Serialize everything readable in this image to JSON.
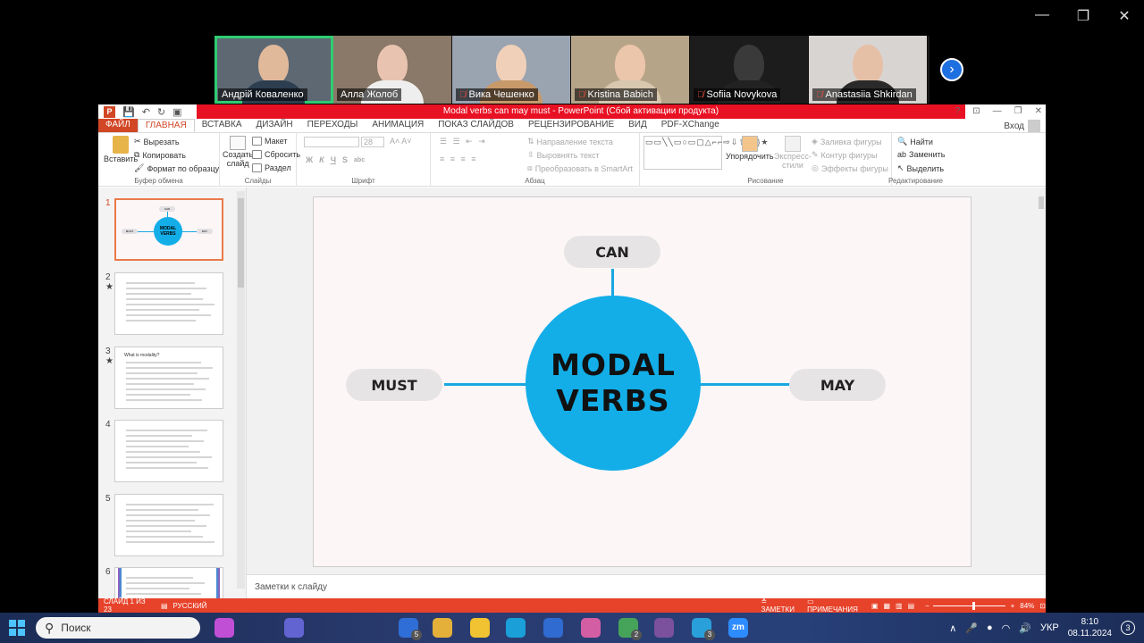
{
  "window_controls": {
    "minimize": "—",
    "restore": "❐",
    "close": "✕"
  },
  "participants": [
    {
      "name": "Андрій Коваленко",
      "muted": false,
      "active": true,
      "bg": "#5d6873",
      "skin": "#e0b89a",
      "shirt": "#2c3e50"
    },
    {
      "name": "Алла Жолоб",
      "muted": false,
      "active": false,
      "bg": "#8a7868",
      "skin": "#e8c4b0",
      "shirt": "#eeeeee"
    },
    {
      "name": "Вика Чешенко",
      "muted": true,
      "active": false,
      "bg": "#9aa3b0",
      "skin": "#f0d0b8",
      "shirt": "#c89a6a"
    },
    {
      "name": "Kristina Babich",
      "muted": true,
      "active": false,
      "bg": "#b6a488",
      "skin": "#ecc6ab",
      "shirt": "#d8c8b0"
    },
    {
      "name": "Sofiia Novykova",
      "muted": true,
      "active": false,
      "bg": "#1c1c1c",
      "skin": "#3a3a3a",
      "shirt": "#222222"
    },
    {
      "name": "Anastasiia Shkirdan",
      "muted": true,
      "active": false,
      "bg": "#d8d4d2",
      "skin": "#e6c0a6",
      "shirt": "#2a2a2a"
    }
  ],
  "next_icon": "›",
  "ppt": {
    "title": "Modal verbs can may must  -  PowerPoint (Сбой активации продукта)",
    "logo": "P",
    "qat": [
      "💾",
      "↶",
      "↻",
      "▣"
    ],
    "title_controls": [
      "?",
      "⊡",
      "—",
      "❐",
      "✕"
    ],
    "tabs": [
      "ФАЙЛ",
      "ГЛАВНАЯ",
      "ВСТАВКА",
      "ДИЗАЙН",
      "ПЕРЕХОДЫ",
      "АНИМАЦИЯ",
      "ПОКАЗ СЛАЙДОВ",
      "РЕЦЕНЗИРОВАНИЕ",
      "ВИД",
      "PDF-XChange"
    ],
    "login": "Вход",
    "ribbon": {
      "clipboard": {
        "paste": "Вставить",
        "cut": "Вырезать",
        "copy": "Копировать",
        "format": "Формат по образцу",
        "label": "Буфер обмена"
      },
      "slides": {
        "create": "Создать",
        "create2": "слайд",
        "layout": "Макет",
        "reset": "Сбросить",
        "section": "Раздел",
        "label": "Слайды"
      },
      "font": {
        "size": "28",
        "label": "Шрифт",
        "bold": "Ж",
        "italic": "К",
        "underline": "Ч",
        "strike": "S",
        "shadow": "abc"
      },
      "paragraph": {
        "direction": "Направление текста",
        "align": "Выровнять текст",
        "smartart": "Преобразовать в SmartArt",
        "label": "Абзац"
      },
      "drawing": {
        "arrange": "Упорядочить",
        "styles": "Экспресс-",
        "styles2": "стили",
        "fill": "Заливка фигуры",
        "outline": "Контур фигуры",
        "effects": "Эффекты фигуры",
        "label": "Рисование"
      },
      "editing": {
        "find": "Найти",
        "replace": "Заменить",
        "select": "Выделить",
        "label": "Редактирование"
      }
    },
    "slides": [
      {
        "num": "1",
        "star": ""
      },
      {
        "num": "2",
        "star": "★"
      },
      {
        "num": "3",
        "star": "★"
      },
      {
        "num": "4",
        "star": ""
      },
      {
        "num": "5",
        "star": ""
      },
      {
        "num": "6",
        "star": ""
      }
    ],
    "thumb1": {
      "center1": "MODAL",
      "center2": "VERBS",
      "top": "CAN",
      "left": "MUST",
      "right": "MAY"
    },
    "thumb3_heading": "What is modality?",
    "slide": {
      "top": "CAN",
      "left": "MUST",
      "right": "MAY",
      "center_line1": "MODAL",
      "center_line2": "VERBS"
    },
    "notes": "Заметки к слайду",
    "status": {
      "slide": "СЛАЙД 1 ИЗ 23",
      "lang": "РУССКИЙ",
      "notes": "ЗАМЕТКИ",
      "comments": "ПРИМЕЧАНИЯ",
      "zoom": "84%"
    }
  },
  "taskbar": {
    "search": "Поиск",
    "apps": [
      {
        "name": "copilot",
        "color": "#c14fd6"
      },
      {
        "name": "chat",
        "color": "#6264d1"
      },
      {
        "name": "mail",
        "color": "#2f6ed6",
        "badge": "5"
      },
      {
        "name": "chrome",
        "color": "#e4b03a"
      },
      {
        "name": "files",
        "color": "#f1c232"
      },
      {
        "name": "edge",
        "color": "#1a9fd8"
      },
      {
        "name": "store",
        "color": "#2f6bd0"
      },
      {
        "name": "snip",
        "color": "#d45ea3"
      },
      {
        "name": "chrome2",
        "color": "#46a35a",
        "badge": "2"
      },
      {
        "name": "viber",
        "color": "#7b519d"
      },
      {
        "name": "telegram",
        "color": "#2aa0da",
        "badge": "3"
      },
      {
        "name": "zoom",
        "color": "#2d8cff",
        "label": "zm"
      }
    ],
    "tray": {
      "lang": "УКР",
      "time": "8:10",
      "date": "08.11.2024",
      "notif": "3",
      "chevron": "∧"
    }
  }
}
